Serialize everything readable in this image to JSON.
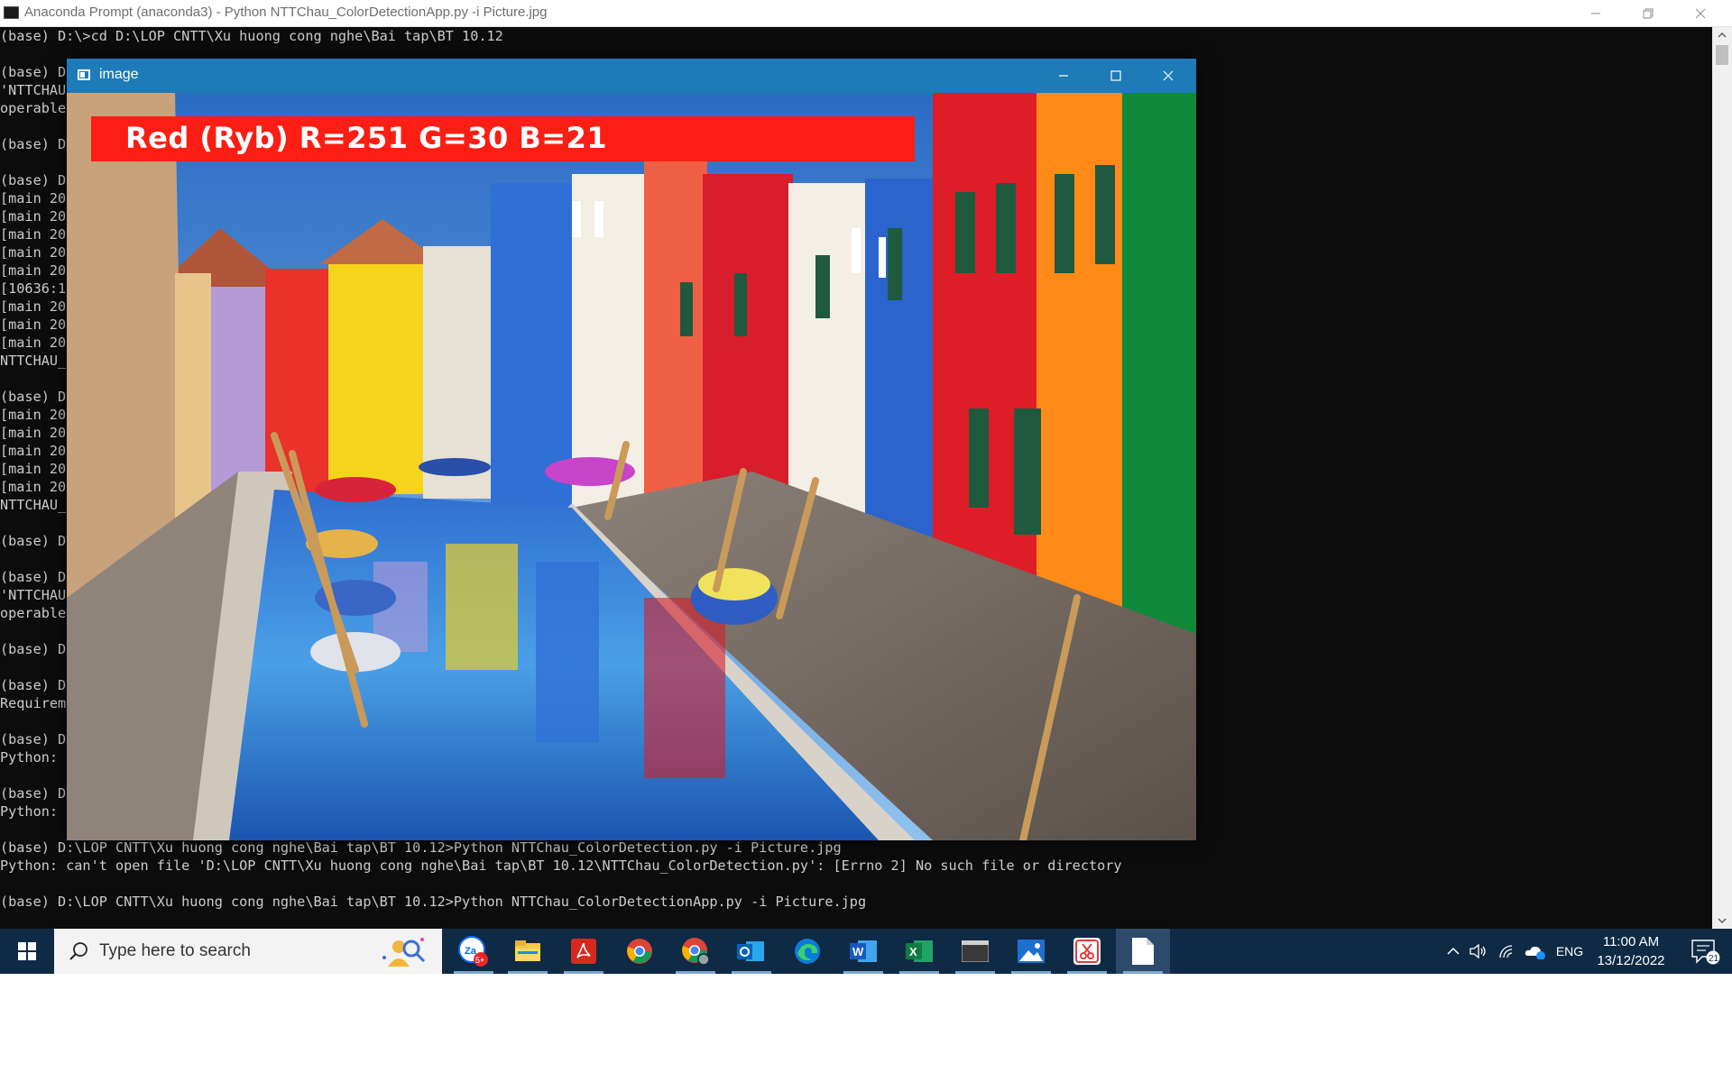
{
  "console": {
    "title": "Anaconda Prompt (anaconda3) - Python  NTTChau_ColorDetectionApp.py -i Picture.jpg",
    "lines": [
      "(base) D:\\>cd D:\\LOP CNTT\\Xu huong cong nghe\\Bai tap\\BT 10.12",
      "",
      "(base) D",
      "'NTTCHAU",
      "operable",
      "",
      "(base) D",
      "",
      "(base) D",
      "[main 20",
      "[main 20",
      "[main 20",
      "[main 20",
      "[main 20",
      "[10636:1",
      "[main 20",
      "[main 20",
      "[main 20",
      "NTTCHAU_",
      "",
      "(base) D",
      "[main 20",
      "[main 20",
      "[main 20",
      "[main 20",
      "[main 20",
      "NTTCHAU_",
      "",
      "(base) D",
      "",
      "(base) D",
      "'NTTCHAU",
      "operable",
      "",
      "(base) D",
      "",
      "(base) D",
      "Requirem",
      "",
      "(base) D",
      "Python: ",
      "",
      "(base) D",
      "Python: ",
      "",
      "(base) D:\\LOP CNTT\\Xu huong cong nghe\\Bai tap\\BT 10.12>Python NTTChau_ColorDetection.py -i Picture.jpg",
      "Python: can't open file 'D:\\LOP CNTT\\Xu huong cong nghe\\Bai tap\\BT 10.12\\NTTChau_ColorDetection.py': [Errno 2] No such file or directory",
      "",
      "(base) D:\\LOP CNTT\\Xu huong cong nghe\\Bai tap\\BT 10.12>Python NTTChau_ColorDetectionApp.py -i Picture.jpg"
    ]
  },
  "image_window": {
    "title": "image",
    "detected_color_text": "Red (Ryb) R=251 G=30 B=21",
    "label_color": "#fb1e15"
  },
  "taskbar": {
    "search_placeholder": "Type here to search",
    "apps": [
      {
        "name": "zalo",
        "badge": "5+"
      },
      {
        "name": "file-explorer"
      },
      {
        "name": "adobe-acrobat"
      },
      {
        "name": "chrome"
      },
      {
        "name": "chrome-profile"
      },
      {
        "name": "outlook"
      },
      {
        "name": "edge"
      },
      {
        "name": "word"
      },
      {
        "name": "excel"
      },
      {
        "name": "terminal"
      },
      {
        "name": "photos"
      },
      {
        "name": "snipping-tool"
      },
      {
        "name": "notepad"
      }
    ],
    "language": "ENG",
    "time": "11:00 AM",
    "date": "13/12/2022",
    "notifications": "21"
  },
  "colors": {
    "console_bg": "#0c0c0c",
    "console_text": "#cccccc",
    "image_titlebar": "#1d7bb8",
    "taskbar_bg": "#0f2a45"
  }
}
